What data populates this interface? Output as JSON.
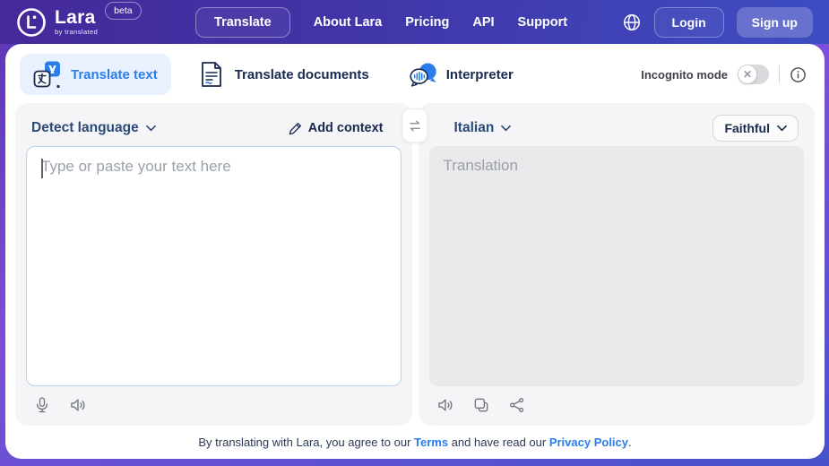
{
  "header": {
    "brand": {
      "name": "Lara",
      "byline": "by translated",
      "beta_label": "beta"
    },
    "nav": [
      {
        "label": "Translate",
        "active": true
      },
      {
        "label": "About Lara",
        "active": false
      },
      {
        "label": "Pricing",
        "active": false
      },
      {
        "label": "API",
        "active": false
      },
      {
        "label": "Support",
        "active": false
      }
    ],
    "auth": {
      "login_label": "Login",
      "signup_label": "Sign up"
    }
  },
  "tabs": {
    "translate_text": "Translate text",
    "translate_documents": "Translate documents",
    "interpreter": "Interpreter"
  },
  "incognito": {
    "label": "Incognito mode",
    "state": "off"
  },
  "source_panel": {
    "language": "Detect language",
    "add_context_label": "Add context",
    "input_placeholder": "Type or paste your text here",
    "input_value": "",
    "icons": [
      "microphone-icon",
      "speaker-icon"
    ]
  },
  "target_panel": {
    "language": "Italian",
    "style_label": "Faithful",
    "output_placeholder": "Translation",
    "icons": [
      "speaker-icon",
      "copy-icon",
      "share-icon"
    ]
  },
  "footer": {
    "text_before": "By translating with Lara, you agree to our ",
    "terms_link": "Terms",
    "text_middle": " and have read our ",
    "privacy_link": "Privacy Policy",
    "text_after": "."
  },
  "colors": {
    "accent_blue": "#2b7de9",
    "header_gradient_start": "#45289a",
    "header_gradient_end": "#3d4dc2",
    "page_gradient_mid": "#7c4fd8",
    "active_tab_bg": "#e8f1fd",
    "panel_bg": "#f5f5f7",
    "output_bg": "#e9e9ec",
    "input_border": "#bad2ee",
    "dark_navy_text": "#182a4e",
    "language_label_text": "#2b4a78"
  }
}
